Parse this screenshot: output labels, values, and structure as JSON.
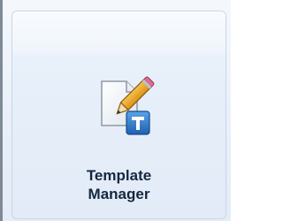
{
  "ribbon_button": {
    "label_line1": "Template",
    "label_line2": "Manager",
    "icon": "template-manager-icon"
  }
}
